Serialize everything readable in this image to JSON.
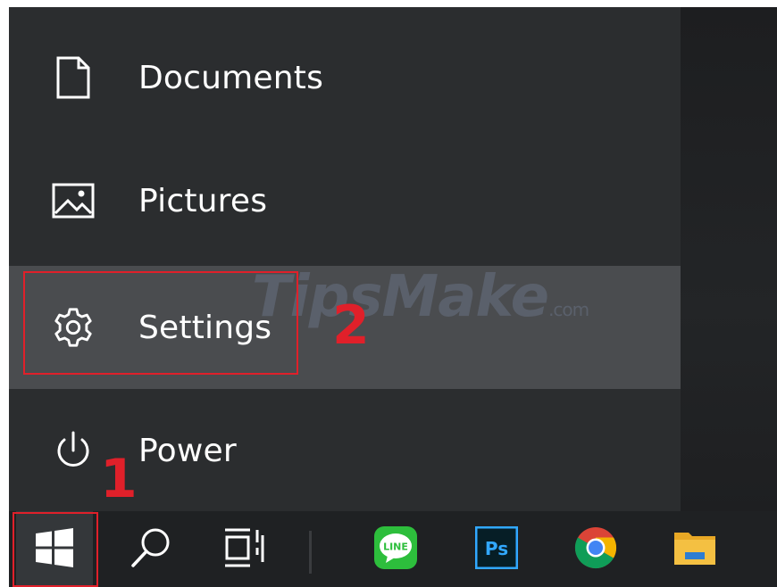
{
  "start_menu": {
    "items": [
      {
        "label": "Documents",
        "icon": "document-icon"
      },
      {
        "label": "Pictures",
        "icon": "pictures-icon"
      },
      {
        "label": "Settings",
        "icon": "gear-icon"
      },
      {
        "label": "Power",
        "icon": "power-icon"
      }
    ]
  },
  "annotations": {
    "step1": "1",
    "step2": "2",
    "highlight_color": "#e0202a"
  },
  "watermark": {
    "text": "TipsMake",
    "suffix": ".com"
  },
  "taskbar": {
    "start": "windows-logo-icon",
    "search": "search-icon",
    "task_view": "task-view-icon",
    "apps": [
      {
        "name": "LINE",
        "icon": "line-app-icon",
        "color": "#2dbe3c"
      },
      {
        "name": "Ps",
        "icon": "photoshop-app-icon",
        "color": "#31a8ff"
      },
      {
        "name": "Chrome",
        "icon": "chrome-app-icon"
      },
      {
        "name": "File Explorer",
        "icon": "file-explorer-icon",
        "color": "#f4c042"
      }
    ]
  }
}
